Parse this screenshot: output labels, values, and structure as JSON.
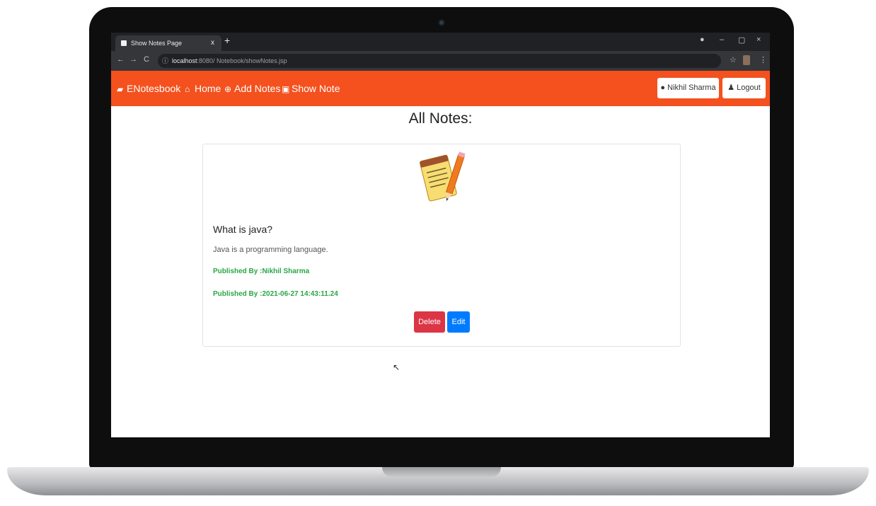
{
  "browser": {
    "tab_title": "Show Notes Page",
    "tab_close": "x",
    "new_tab": "+",
    "url_host": "localhost",
    "url_rest": ":8080/ Notebook/showNotes.jsp",
    "nav_back": "←",
    "nav_forward": "→",
    "nav_reload": "C",
    "win_min": "–",
    "win_max": "▢",
    "win_close": "×"
  },
  "navbar": {
    "brand": "ENotesbook",
    "home": "Home",
    "add_notes": "Add Notes",
    "show_note": "Show Note",
    "user": "Nikhil Sharma",
    "logout": "Logout",
    "colors": {
      "bar": "#f4511e"
    }
  },
  "page": {
    "heading": "All Notes:"
  },
  "note": {
    "title": "What is java?",
    "content": "Java is a programming language.",
    "published_by": "Published By :Nikhil Sharma",
    "published_date": "Published By :2021-06-27 14:43:11.24",
    "delete_label": "Delete",
    "edit_label": "Edit",
    "icon": "notepad-pencil-icon"
  },
  "cursor": "pointer-icon"
}
